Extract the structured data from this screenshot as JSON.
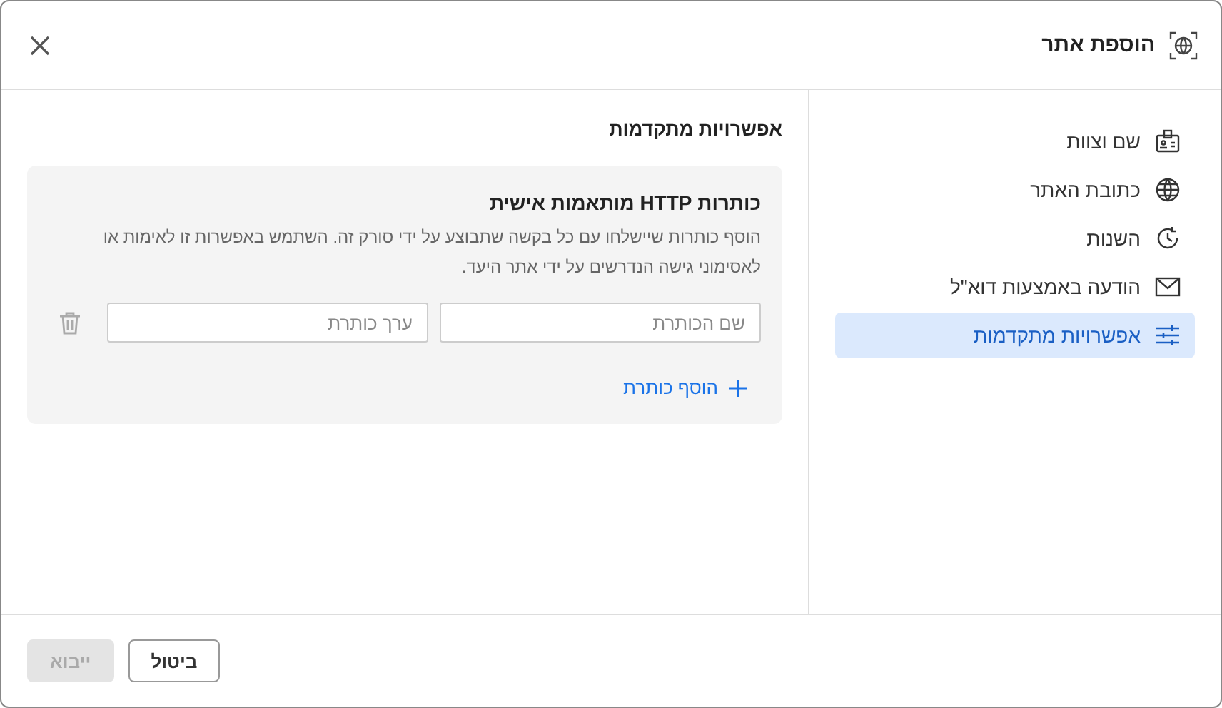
{
  "dialog": {
    "title": "הוספת אתר"
  },
  "sidebar": {
    "items": [
      {
        "label": "שם וצוות",
        "kind": "badge",
        "selected": false
      },
      {
        "label": "כתובת האתר",
        "kind": "globe",
        "selected": false
      },
      {
        "label": "השנות",
        "kind": "history",
        "selected": false
      },
      {
        "label": "הודעה באמצעות דוא\"ל",
        "kind": "mail",
        "selected": false
      },
      {
        "label": "אפשרויות מתקדמות",
        "kind": "sliders",
        "selected": true
      }
    ]
  },
  "content": {
    "heading": "אפשרויות מתקדמות",
    "card": {
      "title": "כותרות HTTP מותאמות אישית",
      "description": "הוסף כותרות שיישלחו עם כל בקשה שתבוצע על ידי סורק זה. השתמש באפשרות זו לאימות או לאסימוני גישה הנדרשים על ידי אתר היעד.",
      "rows": [
        {
          "name_placeholder": "שם הכותרת",
          "value_placeholder": "ערך כותרת"
        }
      ],
      "add_link": "הוסף כותרת"
    }
  },
  "footer": {
    "buttons": [
      {
        "label": "ביטול",
        "disabled": false
      },
      {
        "label": "ייבוא",
        "disabled": true
      }
    ]
  }
}
